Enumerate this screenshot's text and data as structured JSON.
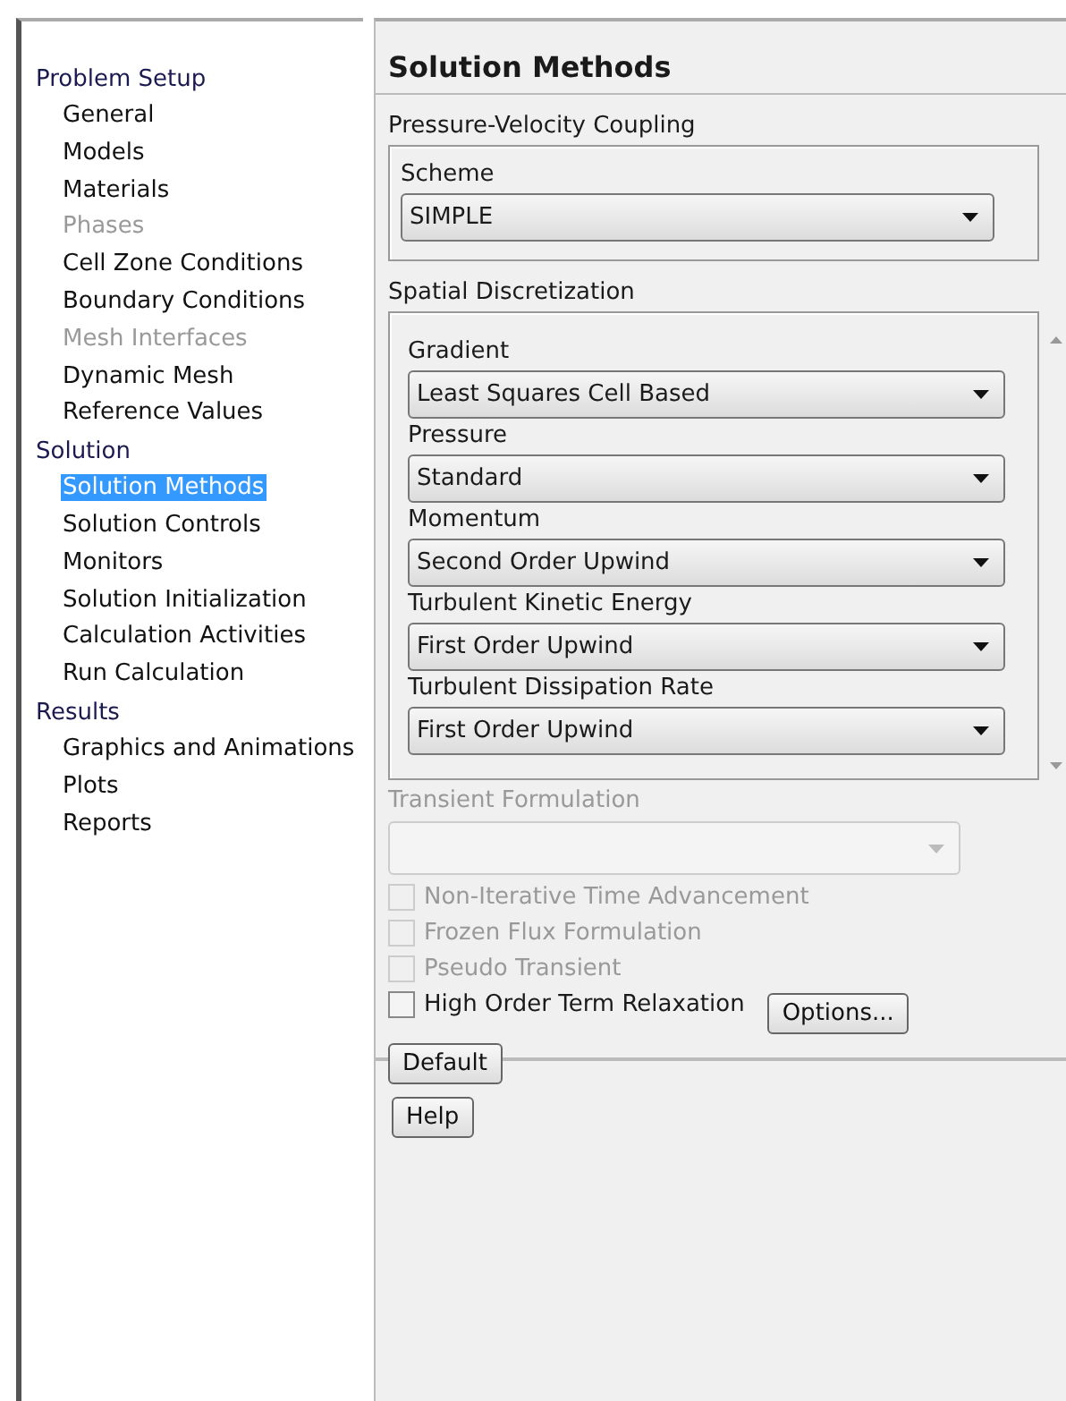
{
  "tree": [
    {
      "label": "Problem Setup",
      "children": [
        {
          "label": "General",
          "selected": false,
          "disabled": false
        },
        {
          "label": "Models",
          "selected": false,
          "disabled": false
        },
        {
          "label": "Materials",
          "selected": false,
          "disabled": false
        },
        {
          "label": "Phases",
          "selected": false,
          "disabled": true
        },
        {
          "label": "Cell Zone Conditions",
          "selected": false,
          "disabled": false
        },
        {
          "label": "Boundary Conditions",
          "selected": false,
          "disabled": false
        },
        {
          "label": "Mesh Interfaces",
          "selected": false,
          "disabled": true
        },
        {
          "label": "Dynamic Mesh",
          "selected": false,
          "disabled": false
        },
        {
          "label": "Reference Values",
          "selected": false,
          "disabled": false
        }
      ]
    },
    {
      "label": "Solution",
      "children": [
        {
          "label": "Solution Methods",
          "selected": true,
          "disabled": false
        },
        {
          "label": "Solution Controls",
          "selected": false,
          "disabled": false
        },
        {
          "label": "Monitors",
          "selected": false,
          "disabled": false
        },
        {
          "label": "Solution Initialization",
          "selected": false,
          "disabled": false
        },
        {
          "label": "Calculation Activities",
          "selected": false,
          "disabled": false
        },
        {
          "label": "Run Calculation",
          "selected": false,
          "disabled": false
        }
      ]
    },
    {
      "label": "Results",
      "children": [
        {
          "label": "Graphics and Animations",
          "selected": false,
          "disabled": false
        },
        {
          "label": "Plots",
          "selected": false,
          "disabled": false
        },
        {
          "label": "Reports",
          "selected": false,
          "disabled": false
        }
      ]
    }
  ],
  "panel": {
    "title": "Solution Methods",
    "coupling": {
      "title": "Pressure-Velocity Coupling",
      "field": {
        "label": "Scheme",
        "value": "SIMPLE"
      }
    },
    "spatial": {
      "title": "Spatial Discretization",
      "fields": [
        {
          "label": "Gradient",
          "value": "Least Squares Cell Based"
        },
        {
          "label": "Pressure",
          "value": "Standard"
        },
        {
          "label": "Momentum",
          "value": "Second Order Upwind"
        },
        {
          "label": "Turbulent Kinetic Energy",
          "value": "First Order Upwind"
        },
        {
          "label": "Turbulent Dissipation Rate",
          "value": "First Order Upwind"
        }
      ]
    },
    "transient": {
      "label": "Transient Formulation",
      "disabled": true
    },
    "checkboxes": [
      {
        "label": "Non-Iterative Time Advancement",
        "checked": false,
        "disabled": true
      },
      {
        "label": "Frozen Flux Formulation",
        "checked": false,
        "disabled": true
      },
      {
        "label": "Pseudo Transient",
        "checked": false,
        "disabled": true
      },
      {
        "label": "High Order Term Relaxation",
        "checked": false,
        "disabled": false
      }
    ],
    "options_button": "Options...",
    "default_button": "Default",
    "help_button": "Help"
  }
}
